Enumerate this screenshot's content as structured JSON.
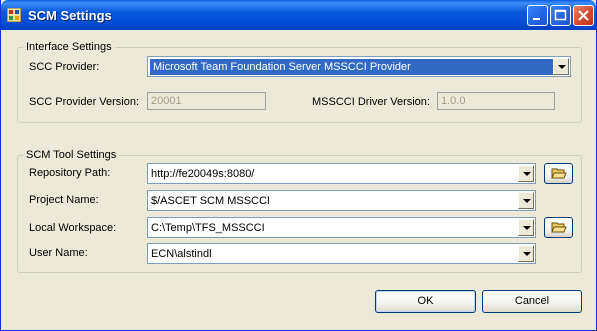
{
  "window": {
    "title": "SCM Settings"
  },
  "interface": {
    "legend": "Interface Settings",
    "scc_provider_label": "SCC Provider:",
    "scc_provider_value": "Microsoft Team Foundation Server MSSCCI Provider",
    "scc_version_label": "SCC Provider Version:",
    "scc_version_value": "20001",
    "driver_version_label": "MSSCCI Driver Version:",
    "driver_version_value": "1.0.0"
  },
  "tool": {
    "legend": "SCM Tool Settings",
    "repo_label": "Repository Path:",
    "repo_value": "http://fe20049s:8080/",
    "project_label": "Project Name:",
    "project_value": "$/ASCET SCM MSSCCI",
    "workspace_label": "Local Workspace:",
    "workspace_value": "C:\\Temp\\TFS_MSSCCI",
    "user_label": "User Name:",
    "user_value": "ECN\\alstindl"
  },
  "buttons": {
    "ok": "OK",
    "cancel": "Cancel"
  },
  "icons": {
    "app": "app-icon",
    "folder": "folder-open-icon"
  }
}
